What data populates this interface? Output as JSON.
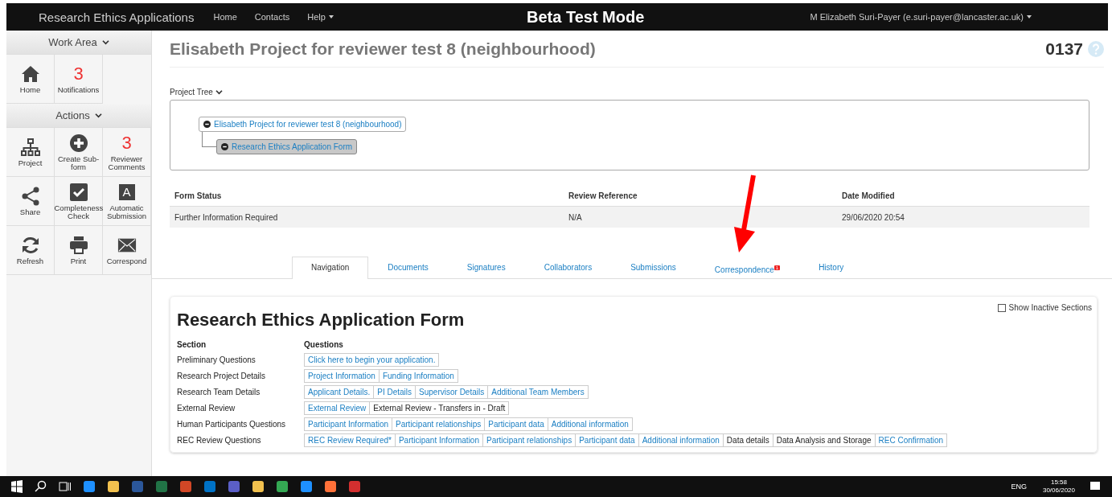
{
  "navbar": {
    "brand": "Research Ethics Applications",
    "links": [
      {
        "label": "Home",
        "dropdown": false
      },
      {
        "label": "Contacts",
        "dropdown": false
      },
      {
        "label": "Help",
        "dropdown": true
      }
    ],
    "mode": "Beta Test Mode",
    "user": "M Elizabeth Suri-Payer (e.suri-payer@lancaster.ac.uk)"
  },
  "sidebar": {
    "groups": [
      {
        "title": "Work Area",
        "items": [
          {
            "label": "Home",
            "kind": "icon"
          },
          {
            "label": "Notifications",
            "kind": "count",
            "count": "3"
          }
        ]
      },
      {
        "title": "Actions",
        "items": [
          {
            "label": "Project",
            "kind": "icon"
          },
          {
            "label": "Create Sub-form",
            "kind": "icon"
          },
          {
            "label": "Reviewer Comments",
            "kind": "count",
            "count": "3"
          },
          {
            "label": "Share",
            "kind": "icon"
          },
          {
            "label": "Completeness Check",
            "kind": "icon"
          },
          {
            "label": "Automatic Submission",
            "kind": "glyph",
            "glyph": "A"
          },
          {
            "label": "Refresh",
            "kind": "icon"
          },
          {
            "label": "Print",
            "kind": "icon"
          },
          {
            "label": "Correspond",
            "kind": "icon"
          }
        ]
      }
    ]
  },
  "page": {
    "title": "Elisabeth Project for reviewer test 8 (neighbourhood)",
    "number": "0137"
  },
  "project_tree": {
    "label": "Project Tree",
    "root": {
      "label": "Elisabeth Project for reviewer test 8 (neighbourhood)",
      "expanded": true,
      "selected": false,
      "children": [
        {
          "label": "Research Ethics Application Form",
          "expanded": true,
          "selected": true
        }
      ]
    }
  },
  "form_info": {
    "columns": [
      "Form Status",
      "Review Reference",
      "Date Modified"
    ],
    "values": [
      "Further Information Required",
      "N/A",
      "29/06/2020 20:54"
    ]
  },
  "tabs": [
    {
      "label": "Navigation",
      "selected": true
    },
    {
      "label": "Documents",
      "selected": false
    },
    {
      "label": "Signatures",
      "selected": false
    },
    {
      "label": "Collaborators",
      "selected": false
    },
    {
      "label": "Submissions",
      "selected": false
    },
    {
      "label": "Correspondence",
      "selected": false,
      "badge": "1"
    },
    {
      "label": "History",
      "selected": false
    }
  ],
  "form": {
    "title": "Research Ethics Application Form",
    "show_inactive": {
      "label": "Show Inactive Sections",
      "checked": false
    },
    "columns": [
      "Section",
      "Questions"
    ],
    "rows": [
      {
        "section": "Preliminary Questions",
        "questions": [
          {
            "label": "Click here to begin your application.",
            "kind": "link"
          }
        ]
      },
      {
        "section": "Research Project Details",
        "questions": [
          {
            "label": "Project Information",
            "kind": "link"
          },
          {
            "label": "Funding Information",
            "kind": "link"
          }
        ]
      },
      {
        "section": "Research Team Details",
        "questions": [
          {
            "label": "Applicant Details.",
            "kind": "link"
          },
          {
            "label": "PI Details",
            "kind": "link"
          },
          {
            "label": "Supervisor Details",
            "kind": "link"
          },
          {
            "label": "Additional Team Members",
            "kind": "link"
          }
        ]
      },
      {
        "section": "External Review",
        "questions": [
          {
            "label": "External Review",
            "kind": "link"
          },
          {
            "label": "External Review - Transfers in - Draft",
            "kind": "text"
          }
        ]
      },
      {
        "section": "Human Participants Questions",
        "questions": [
          {
            "label": "Participant Information",
            "kind": "link"
          },
          {
            "label": "Participant relationships",
            "kind": "link"
          },
          {
            "label": "Participant data",
            "kind": "link"
          },
          {
            "label": "Additional information",
            "kind": "link"
          }
        ]
      },
      {
        "section": "REC Review Questions",
        "questions": [
          {
            "label": "REC Review Required*",
            "kind": "link"
          },
          {
            "label": "Participant Information",
            "kind": "link"
          },
          {
            "label": "Participant relationships",
            "kind": "link"
          },
          {
            "label": "Participant data",
            "kind": "link"
          },
          {
            "label": "Additional information",
            "kind": "link"
          },
          {
            "label": "Data details",
            "kind": "text"
          },
          {
            "label": "Data Analysis and Storage",
            "kind": "text"
          },
          {
            "label": "REC Confirmation",
            "kind": "link"
          }
        ]
      }
    ]
  },
  "taskbar": {
    "language": "ENG",
    "time": "15:58",
    "date": "30/06/2020"
  }
}
